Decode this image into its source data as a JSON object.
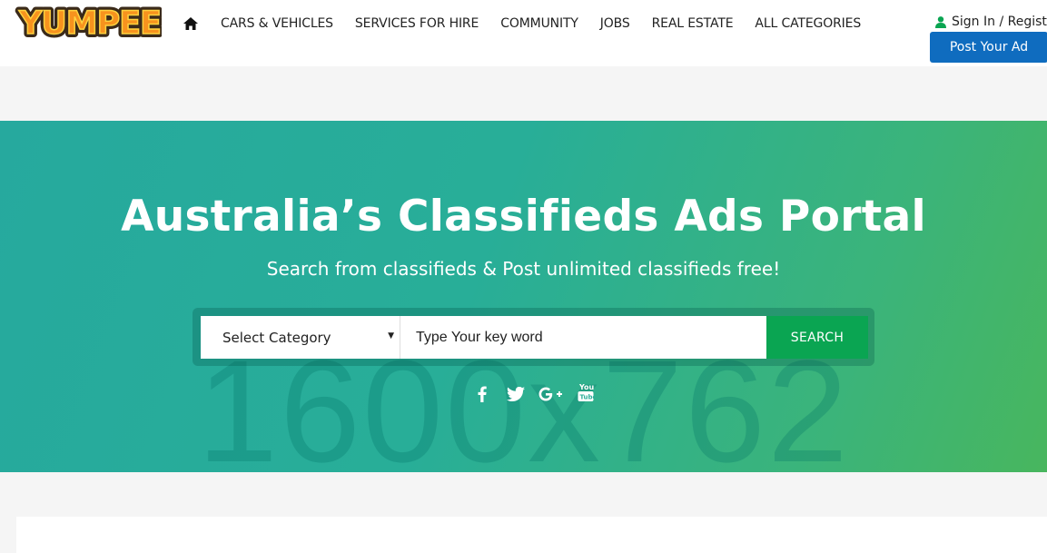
{
  "brand": {
    "logo_text": "YUMPEE"
  },
  "nav": {
    "items": [
      {
        "label": "CARS & VEHICLES"
      },
      {
        "label": "SERVICES FOR HIRE"
      },
      {
        "label": "COMMUNITY"
      },
      {
        "label": "JOBS"
      },
      {
        "label": "REAL ESTATE"
      },
      {
        "label": "ALL CATEGORIES"
      }
    ]
  },
  "account": {
    "signin_label": "Sign In / Registe",
    "post_ad_label": "Post Your Ad"
  },
  "hero": {
    "title": "Australia’s Classifieds Ads Portal",
    "subtitle": "Search from classifieds & Post unlimited classifieds free!",
    "watermark": "1600x762"
  },
  "search": {
    "category_selected": "Select Category",
    "keyword_placeholder": "Type Your key word",
    "button_label": "SEARCH"
  },
  "social": {
    "icons": [
      "facebook-icon",
      "twitter-icon",
      "google-plus-icon",
      "youtube-icon"
    ]
  },
  "colors": {
    "primary_blue": "#0f6cbf",
    "search_green": "#0aa552",
    "hero_start": "#26a99e",
    "hero_end": "#48b65e",
    "logo_orange": "#f7931e"
  }
}
